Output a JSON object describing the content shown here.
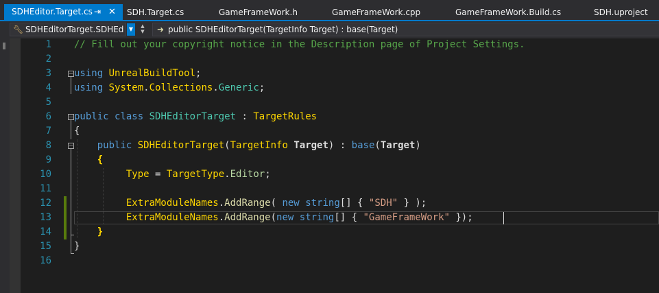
{
  "tabs": [
    {
      "label": "SDHEditor.Target.cs",
      "active": true
    },
    {
      "label": "SDH.Target.cs"
    },
    {
      "label": "GameFrameWork.h"
    },
    {
      "label": "GameFrameWork.cpp"
    },
    {
      "label": "GameFrameWork.Build.cs"
    },
    {
      "label": "SDH.uproject"
    }
  ],
  "tab_pin_icon": "pin-icon",
  "tab_close_icon": "close-icon",
  "nav": {
    "type_selector": "SDHEditorTarget.SDHEd",
    "member_selector": "public SDHEditorTarget(TargetInfo Target) : base(Target)"
  },
  "colors": {
    "accent": "#007acc",
    "background": "#1e1e1e",
    "line_number": "#2b91af",
    "comment": "#57a64a",
    "keyword": "#569cd6",
    "type": "#4ec9b0",
    "string": "#d69d85",
    "change_marker": "#587c0c"
  },
  "line_numbers": [
    "1",
    "2",
    "3",
    "4",
    "5",
    "6",
    "7",
    "8",
    "9",
    "10",
    "11",
    "12",
    "13",
    "14",
    "15",
    "16"
  ],
  "code": {
    "l1": {
      "comment": "// Fill out your copyright notice in the Description page of Project Settings."
    },
    "l3": {
      "kw": "using",
      "ns": "UnrealBuildTool",
      "end": ";"
    },
    "l4": {
      "kw": "using",
      "ns1": "System",
      "dot1": ".",
      "ns2": "Collections",
      "dot2": ".",
      "type": "Generic",
      "end": ";"
    },
    "l6": {
      "kw1": "public",
      "kw2": "class",
      "type": "SDHEditorTarget",
      "colon": " : ",
      "base": "TargetRules"
    },
    "l7": {
      "brace": "{"
    },
    "l8": {
      "kw": "public",
      "name": "SDHEditorTarget",
      "open": "(",
      "ptype": "TargetInfo",
      "pname": "Target",
      "close": ")",
      "colon": " : ",
      "basekw": "base",
      "open2": "(",
      "arg": "Target",
      "close2": ")"
    },
    "l9": {
      "brace": "{"
    },
    "l10": {
      "prop": "Type",
      "eq": " = ",
      "etype": "TargetType",
      "dot": ".",
      "member": "Editor",
      "end": ";"
    },
    "l12": {
      "obj": "ExtraModuleNames",
      "dot": ".",
      "method": "AddRange",
      "open": "( ",
      "kw1": "new",
      "kw2": "string",
      "arr": "[] { ",
      "str": "\"SDH\"",
      "end": " } );"
    },
    "l13": {
      "obj": "ExtraModuleNames",
      "dot": ".",
      "method": "AddRange",
      "open": "(",
      "kw1": "new",
      "kw2": "string",
      "arr": "[] { ",
      "str": "\"GameFrameWork\"",
      "end": " });"
    },
    "l14": {
      "brace": "}"
    },
    "l15": {
      "brace": "}"
    }
  }
}
